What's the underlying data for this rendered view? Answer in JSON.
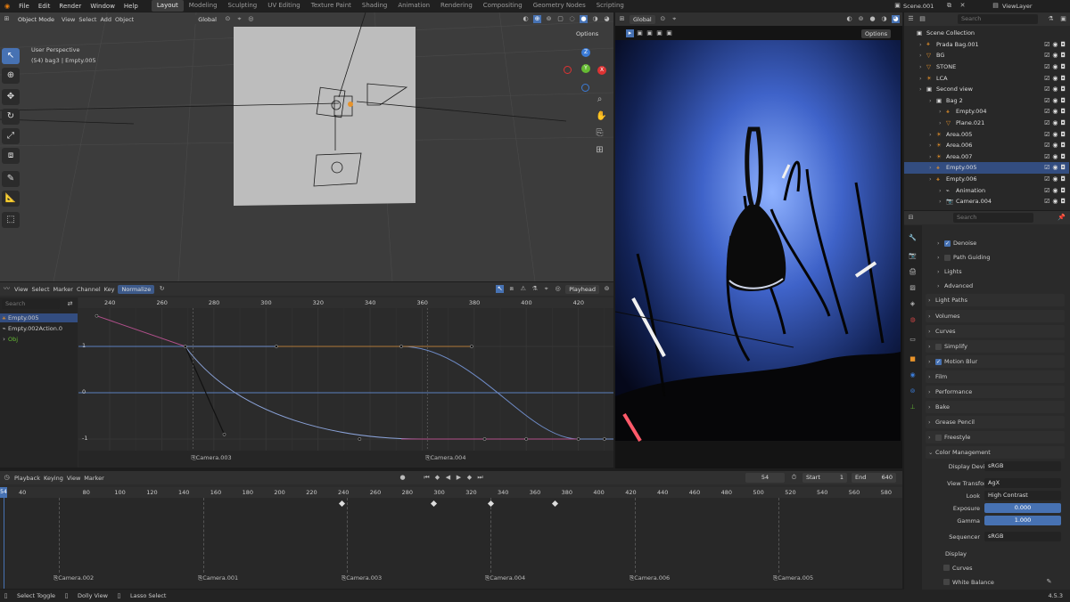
{
  "topbar": {
    "menus": [
      "File",
      "Edit",
      "Render",
      "Window",
      "Help"
    ],
    "workspaces": [
      "Layout",
      "Modeling",
      "Sculpting",
      "UV Editing",
      "Texture Paint",
      "Shading",
      "Animation",
      "Rendering",
      "Compositing",
      "Geometry Nodes",
      "Scripting"
    ],
    "scene": "Scene.001",
    "viewlayer": "ViewLayer"
  },
  "viewport": {
    "mode": "Object Mode",
    "menus": [
      "View",
      "Select",
      "Add",
      "Object"
    ],
    "orientation": "Global",
    "options": "Options",
    "perspective": "User Perspective",
    "info": "(54) bag3 | Empty.005",
    "gizmo": {
      "x": "X",
      "y": "Y",
      "z": "Z"
    }
  },
  "render_view": {
    "orientation": "Global",
    "options": "Options"
  },
  "graph": {
    "menus": [
      "View",
      "Select",
      "Marker",
      "Channel",
      "Key"
    ],
    "normalize": "Normalize",
    "pivot": "Playhead",
    "search_placeholder": "Search",
    "channels": [
      "Empty.005",
      "Empty.002Action.0",
      "Obj"
    ],
    "ticks": [
      "240",
      "260",
      "280",
      "300",
      "320",
      "340",
      "360",
      "380",
      "400",
      "420"
    ],
    "yvals": [
      "1",
      "0",
      "-1"
    ],
    "markers": [
      "Camera.003",
      "Camera.004"
    ]
  },
  "timeline": {
    "menus": [
      "Playback",
      "Keying",
      "View",
      "Marker"
    ],
    "current": "54",
    "start_label": "Start",
    "start": "1",
    "end_label": "End",
    "end": "640",
    "ticks": [
      "40",
      "80",
      "100",
      "120",
      "140",
      "160",
      "180",
      "200",
      "220",
      "240",
      "260",
      "280",
      "300",
      "320",
      "340",
      "360",
      "380",
      "400",
      "420",
      "440",
      "460",
      "480",
      "500",
      "520",
      "540",
      "560",
      "580",
      "600"
    ],
    "markers": [
      "Camera.002",
      "Camera.001",
      "Camera.003",
      "Camera.004",
      "Camera.006",
      "Camera.005"
    ]
  },
  "outliner": {
    "search_placeholder": "Search",
    "items": [
      {
        "label": "Scene Collection",
        "indent": 0
      },
      {
        "label": "Prada Bag.001",
        "indent": 1
      },
      {
        "label": "BG",
        "indent": 1
      },
      {
        "label": "STONE",
        "indent": 1
      },
      {
        "label": "LCA",
        "indent": 1
      },
      {
        "label": "Second view",
        "indent": 1
      },
      {
        "label": "Bag 2",
        "indent": 2
      },
      {
        "label": "Empty.004",
        "indent": 3
      },
      {
        "label": "Plane.021",
        "indent": 3
      },
      {
        "label": "Area.005",
        "indent": 2
      },
      {
        "label": "Area.006",
        "indent": 2
      },
      {
        "label": "Area.007",
        "indent": 2
      },
      {
        "label": "Empty.005",
        "indent": 2
      },
      {
        "label": "Empty.006",
        "indent": 2
      },
      {
        "label": "Animation",
        "indent": 3
      },
      {
        "label": "Camera.004",
        "indent": 3
      }
    ]
  },
  "properties": {
    "search_placeholder": "Search",
    "panels": [
      "Denoise",
      "Path Guiding",
      "Lights",
      "Advanced",
      "Light Paths",
      "Volumes",
      "Curves",
      "Simplify",
      "Motion Blur",
      "Film",
      "Performance",
      "Bake",
      "Grease Pencil",
      "Freestyle",
      "Color Management"
    ],
    "cm": {
      "display_device_label": "Display Device",
      "display_device": "sRGB",
      "view_transform_label": "View Transform",
      "view_transform": "AgX",
      "look_label": "Look",
      "look": "High Contrast",
      "exposure_label": "Exposure",
      "exposure": "0.000",
      "gamma_label": "Gamma",
      "gamma": "1.000",
      "sequencer_label": "Sequencer",
      "sequencer": "sRGB"
    },
    "sub": [
      "Display",
      "Curves",
      "White Balance"
    ]
  },
  "statusbar": {
    "items": [
      "Select Toggle",
      "Dolly View",
      "Lasso Select"
    ],
    "version": "4.5.3"
  },
  "colors": {
    "accent": "#4772b3",
    "selection": "#334d80",
    "curve_blue": "#5b7fbf",
    "curve_pink": "#b04f8a"
  }
}
